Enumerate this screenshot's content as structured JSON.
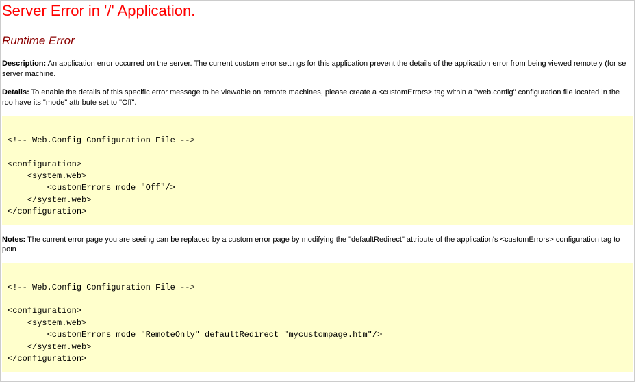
{
  "title": "Server Error in '/' Application.",
  "subtitle": "Runtime Error",
  "labels": {
    "description": "Description:",
    "details": "Details:",
    "notes": "Notes:"
  },
  "description_text": " An application error occurred on the server. The current custom error settings for this application prevent the details of the application error from being viewed remotely (for se server machine.",
  "details_text": " To enable the details of this specific error message to be viewable on remote machines, please create a <customErrors> tag within a \"web.config\" configuration file located in the roo have its \"mode\" attribute set to \"Off\".",
  "code_block_1": "\n<!-- Web.Config Configuration File -->\n\n<configuration>\n    <system.web>\n        <customErrors mode=\"Off\"/>\n    </system.web>\n</configuration>\n",
  "notes_text": " The current error page you are seeing can be replaced by a custom error page by modifying the \"defaultRedirect\" attribute of the application's <customErrors> configuration tag to poin",
  "code_block_2": "\n<!-- Web.Config Configuration File -->\n\n<configuration>\n    <system.web>\n        <customErrors mode=\"RemoteOnly\" defaultRedirect=\"mycustompage.htm\"/>\n    </system.web>\n</configuration>\n"
}
